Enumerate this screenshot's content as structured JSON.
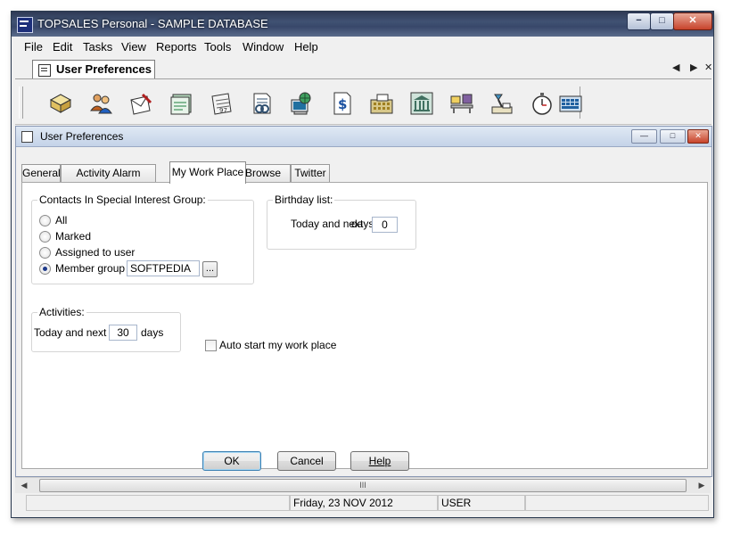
{
  "window": {
    "title": "TOPSALES Personal - SAMPLE DATABASE",
    "controls": {
      "minimize": "−",
      "maximize": "□",
      "close": "✕"
    }
  },
  "menu": [
    "File",
    "Edit",
    "Tasks",
    "View",
    "Reports",
    "Tools",
    "Window",
    "Help"
  ],
  "doc_tab": {
    "label": "User Preferences",
    "controls": {
      "prev": "◀",
      "next": "▶",
      "close": "✕"
    }
  },
  "toolbar": {
    "buttons": [
      {
        "icon": "open-folder-icon",
        "color": "#e0c060"
      },
      {
        "icon": "contacts-people-icon",
        "color": "#c06020"
      },
      {
        "icon": "letter-write-icon",
        "color": "#b02020"
      },
      {
        "icon": "card-file-icon",
        "color": "#208040"
      },
      {
        "icon": "calendar-icon",
        "color": "#606060"
      },
      {
        "icon": "document-icon",
        "color": "#305070"
      },
      {
        "icon": "web-computer-icon",
        "color": "#2070a0"
      },
      {
        "icon": "dollar-document-icon",
        "color": "#1a50a0"
      },
      {
        "icon": "calculator-register-icon",
        "color": "#a08020"
      },
      {
        "icon": "bank-building-icon",
        "color": "#407060"
      },
      {
        "icon": "store-items-icon",
        "color": "#8060a0"
      },
      {
        "icon": "desk-lamp-icon",
        "color": "#4090c0"
      },
      {
        "icon": "stopwatch-icon",
        "color": "#606060"
      },
      {
        "icon": "keyboard-calc-icon",
        "color": "#2060a0"
      }
    ]
  },
  "child": {
    "title": "User Preferences",
    "controls": {
      "minimize": "—",
      "maximize": "□",
      "close": "✕"
    }
  },
  "tabs": [
    "General",
    "Activity Alarm Setting",
    "My Work Place",
    "Browse List",
    "Twitter"
  ],
  "active_tab": "My Work Place",
  "contacts_group": {
    "title": "Contacts In Special Interest Group:",
    "options": [
      "All",
      "Marked",
      "Assigned to user",
      "Member group"
    ],
    "selected": "Member group",
    "member_group_value": "SOFTPEDIA",
    "browse_label": "..."
  },
  "birthday_group": {
    "title": "Birthday list:",
    "label_before": "Today and next",
    "value": "0",
    "label_after": "days"
  },
  "activities_group": {
    "title": "Activities:",
    "label_before": "Today and next",
    "value": "30",
    "label_after": "days"
  },
  "auto_start": {
    "label": "Auto start my work place",
    "checked": false
  },
  "buttons": {
    "ok": "OK",
    "cancel": "Cancel",
    "help": "Help"
  },
  "scrollbar": {
    "left": "◀",
    "right": "▶",
    "grip": "III"
  },
  "status": {
    "date": "Friday, 23 NOV 2012",
    "user": "USER"
  }
}
